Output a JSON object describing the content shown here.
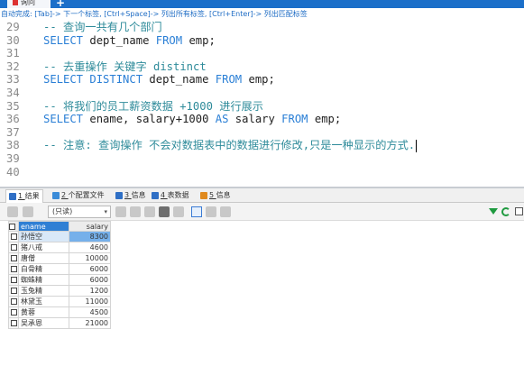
{
  "tabbar": {
    "active_tab": "询问",
    "add_label": "+"
  },
  "hint": "自动完成: [Tab]-> 下一个标签, [Ctrl+Space]-> 列出所有标签, [Ctrl+Enter]-> 列出匹配标签",
  "editor": {
    "lines": [
      {
        "num": "29",
        "comment": "-- 查询一共有几个部门",
        "sql": []
      },
      {
        "num": "30",
        "comment": "",
        "sql": [
          {
            "t": "kw",
            "v": "SELECT"
          },
          {
            "t": "id",
            "v": " dept_name "
          },
          {
            "t": "kw",
            "v": "FROM"
          },
          {
            "t": "id",
            "v": " emp;"
          }
        ]
      },
      {
        "num": "31",
        "comment": "",
        "sql": []
      },
      {
        "num": "32",
        "comment": "-- 去重操作 关键字 distinct",
        "sql": []
      },
      {
        "num": "33",
        "comment": "",
        "sql": [
          {
            "t": "kw",
            "v": "SELECT DISTINCT"
          },
          {
            "t": "id",
            "v": " dept_name "
          },
          {
            "t": "kw",
            "v": "FROM"
          },
          {
            "t": "id",
            "v": " emp;"
          }
        ]
      },
      {
        "num": "34",
        "comment": "",
        "sql": []
      },
      {
        "num": "35",
        "comment": "-- 将我们的员工薪资数据 +1000 进行展示",
        "sql": []
      },
      {
        "num": "36",
        "comment": "",
        "sql": [
          {
            "t": "kw",
            "v": "SELECT"
          },
          {
            "t": "id",
            "v": " ename, salary+1000 "
          },
          {
            "t": "kw",
            "v": "AS"
          },
          {
            "t": "id",
            "v": " salary "
          },
          {
            "t": "kw",
            "v": "FROM"
          },
          {
            "t": "id",
            "v": " emp;"
          }
        ]
      },
      {
        "num": "37",
        "comment": "",
        "sql": []
      },
      {
        "num": "38",
        "comment": "-- 注意: 查询操作 不会对数据表中的数据进行修改,只是一种显示的方式.",
        "sql": []
      },
      {
        "num": "39",
        "comment": "",
        "sql": []
      },
      {
        "num": "40",
        "comment": "",
        "sql": []
      }
    ]
  },
  "result_tabs": [
    {
      "num": "1",
      "label": "结果",
      "color": "#2f6fc5"
    },
    {
      "num": "2",
      "label": "个配置文件",
      "color": "#3a8bd8"
    },
    {
      "num": "3",
      "label": "信息",
      "color": "#2f6fc5"
    },
    {
      "num": "4",
      "label": "表数据",
      "color": "#2f6fc5"
    },
    {
      "num": "5",
      "label": "信息",
      "color": "#e08a1e"
    }
  ],
  "toolbar": {
    "readonly_select": "(只读)",
    "chevron": "▾"
  },
  "grid": {
    "columns": [
      "ename",
      "salary"
    ],
    "rows": [
      [
        "孙悟空",
        "8300"
      ],
      [
        "猪八戒",
        "4600"
      ],
      [
        "唐僧",
        "10000"
      ],
      [
        "白骨精",
        "6000"
      ],
      [
        "蜘蛛精",
        "6000"
      ],
      [
        "玉兔精",
        "1200"
      ],
      [
        "林黛玉",
        "11000"
      ],
      [
        "黄蓉",
        "4500"
      ],
      [
        "吴承恩",
        "21000"
      ]
    ],
    "selected_row": 0
  }
}
